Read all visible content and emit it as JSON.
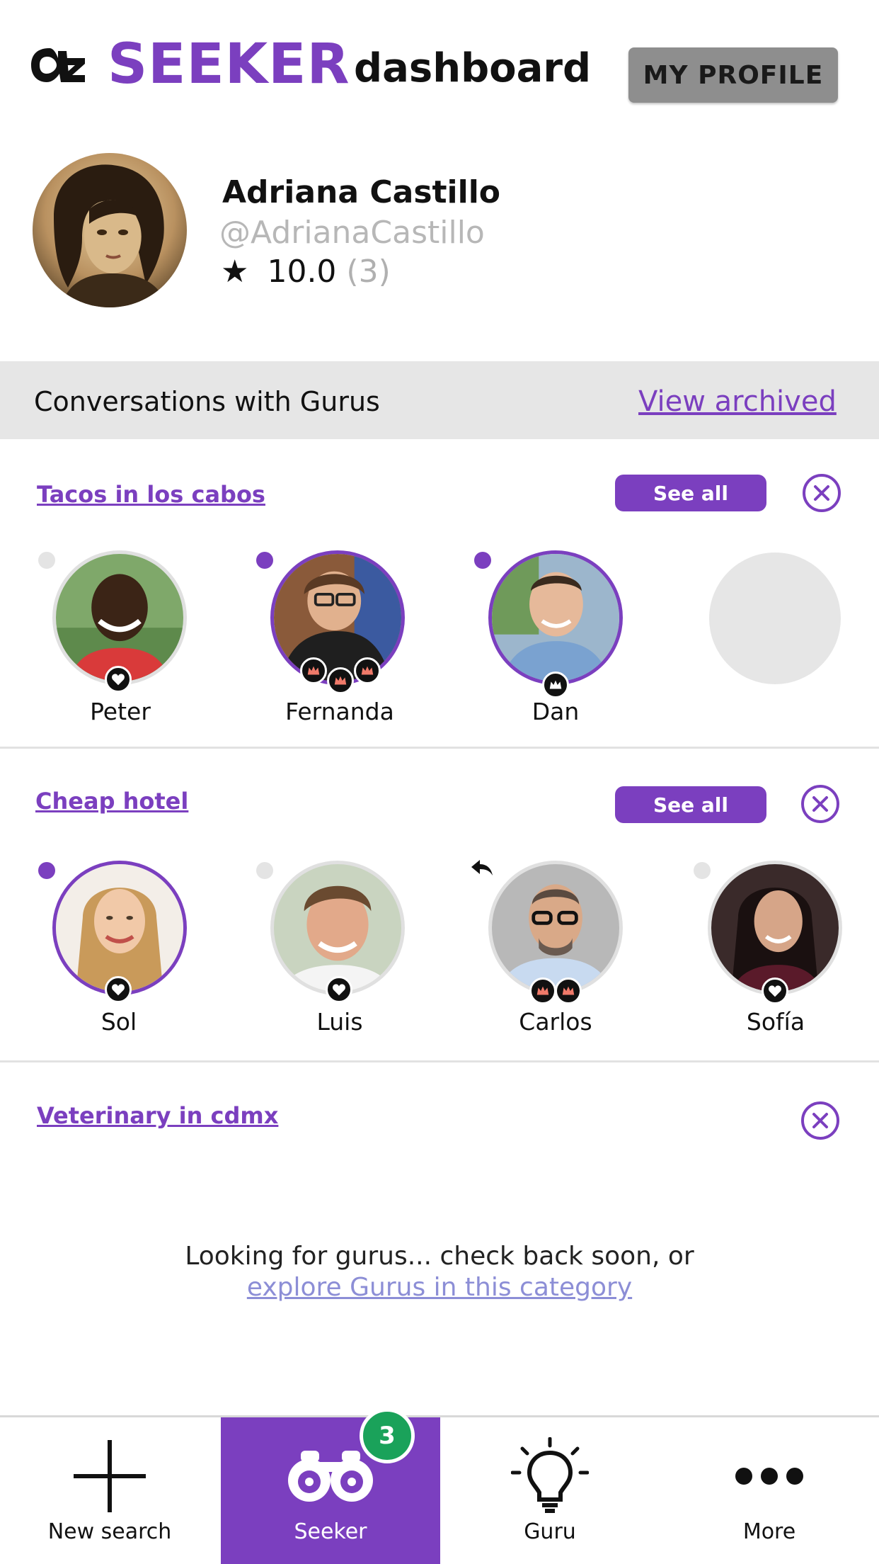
{
  "header": {
    "brand": "SEEKER",
    "subtitle": "dashboard",
    "profile_button": "MY PROFILE",
    "logo_icon": "az-logo-icon"
  },
  "profile": {
    "name": "Adriana Castillo",
    "handle": "@AdrianaCastillo",
    "rating": "10.0",
    "rating_count": "(3)"
  },
  "conversations": {
    "title": "Conversations with Gurus",
    "view_archived": "View archived"
  },
  "groups": [
    {
      "title": "Tacos in los cabos",
      "see_all": "See all",
      "gurus": [
        {
          "name": "Peter",
          "active": false,
          "unread": false,
          "badges": [
            "heart"
          ]
        },
        {
          "name": "Fernanda",
          "active": true,
          "unread": true,
          "badges": [
            "crown-red",
            "crown-red",
            "crown-red"
          ]
        },
        {
          "name": "Dan",
          "active": true,
          "unread": true,
          "badges": [
            "crown-white"
          ]
        }
      ]
    },
    {
      "title": "Cheap hotel",
      "see_all": "See all",
      "gurus": [
        {
          "name": "Sol",
          "active": true,
          "unread": true,
          "badges": [
            "heart"
          ]
        },
        {
          "name": "Luis",
          "active": false,
          "unread": false,
          "badges": [
            "heart"
          ]
        },
        {
          "name": "Carlos",
          "active": false,
          "reply": true,
          "badges": [
            "crown-red",
            "crown-red"
          ]
        },
        {
          "name": "Sofía",
          "active": false,
          "unread": false,
          "badges": [
            "heart"
          ]
        }
      ]
    },
    {
      "title": "Veterinary in cdmx",
      "empty_text": "Looking for gurus... check back soon, or",
      "empty_link": "explore Gurus in this category"
    }
  ],
  "nav": {
    "items": [
      {
        "label": "New search",
        "icon": "plus-icon"
      },
      {
        "label": "Seeker",
        "icon": "binoculars-icon",
        "active": true,
        "badge": "3"
      },
      {
        "label": "Guru",
        "icon": "lightbulb-icon"
      },
      {
        "label": "More",
        "icon": "more-dots-icon"
      }
    ]
  },
  "colors": {
    "accent": "#7b3fbf",
    "badge_green": "#1aa25a",
    "band_gray": "#e6e6e6"
  }
}
